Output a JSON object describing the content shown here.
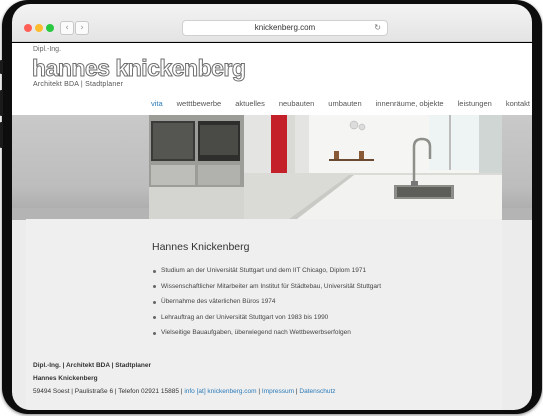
{
  "browser": {
    "url": "knickenberg.com",
    "back_icon": "chevron-left-icon",
    "forward_icon": "chevron-right-icon",
    "reload_icon": "reload-icon"
  },
  "header": {
    "prefix": "Dipl.-Ing.",
    "logo_text": "hannes knickenberg",
    "subtitle": "Architekt BDA | Stadtplaner"
  },
  "nav": {
    "items": [
      {
        "label": "vita",
        "active": true
      },
      {
        "label": "wetttbewerbe",
        "active": false
      },
      {
        "label": "aktuelles",
        "active": false
      },
      {
        "label": "neubauten",
        "active": false
      },
      {
        "label": "umbauten",
        "active": false
      },
      {
        "label": "innenräume, objekte",
        "active": false
      },
      {
        "label": "leistungen",
        "active": false
      },
      {
        "label": "kontakt",
        "active": false
      }
    ],
    "active_color": "#2a7ab9"
  },
  "main": {
    "heading": "Hannes Knickenberg",
    "bullets": [
      "Studium an der Universität Stuttgart und dem IIT Chicago, Diplom 1971",
      "Wissenschaftlicher Mitarbeiter am Institut für Städtebau, Universität Stuttgart",
      "Übernahme des väterlichen Büros 1974",
      "Lehrauftrag an der Universität Stuttgart von 1983 bis 1990",
      "Vielseitige Bauaufgaben, überwiegend nach Wettbewerbserfolgen"
    ]
  },
  "footer": {
    "line1": "Dipl.-Ing. | Architekt BDA | Stadtplaner",
    "line2": "Hannes Knickenberg",
    "address": "59494 Soest | Paulistraße 6 | Telefon 02921 15885 |",
    "email": "info [at] knickenberg.com",
    "sep1": "|",
    "impressum": "Impressum",
    "sep2": "|",
    "datenschutz": "Datenschutz"
  },
  "colors": {
    "link": "#2a7ab9",
    "accent_red": "#c4202a"
  }
}
